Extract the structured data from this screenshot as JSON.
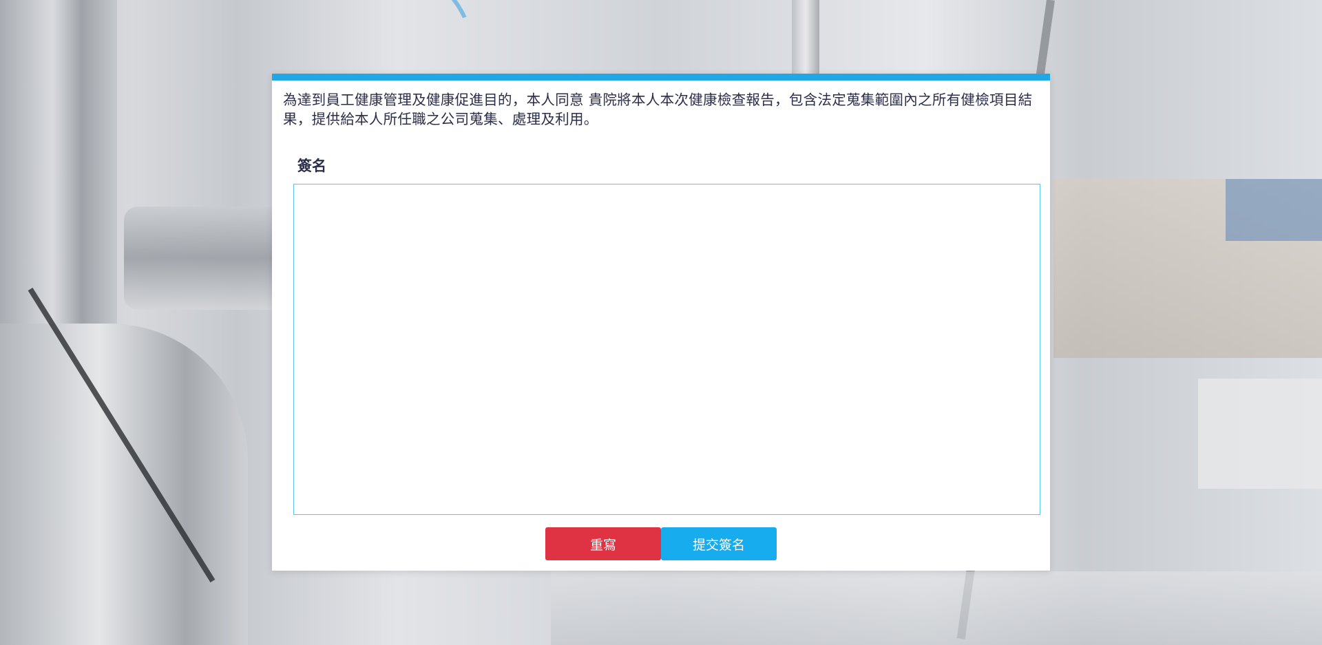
{
  "consent": {
    "text": "為達到員工健康管理及健康促進目的，本人同意 貴院將本人本次健康檢查報告，包含法定蒐集範圍內之所有健檢項目結果，提供給本人所任職之公司蒐集、處理及利用。"
  },
  "signature": {
    "label": "簽名"
  },
  "buttons": {
    "reset_label": "重寫",
    "submit_label": "提交簽名"
  },
  "colors": {
    "accent": "#1fa7e6",
    "reset": "#df3344",
    "submit": "#16acee",
    "text": "#2b2e4a"
  }
}
